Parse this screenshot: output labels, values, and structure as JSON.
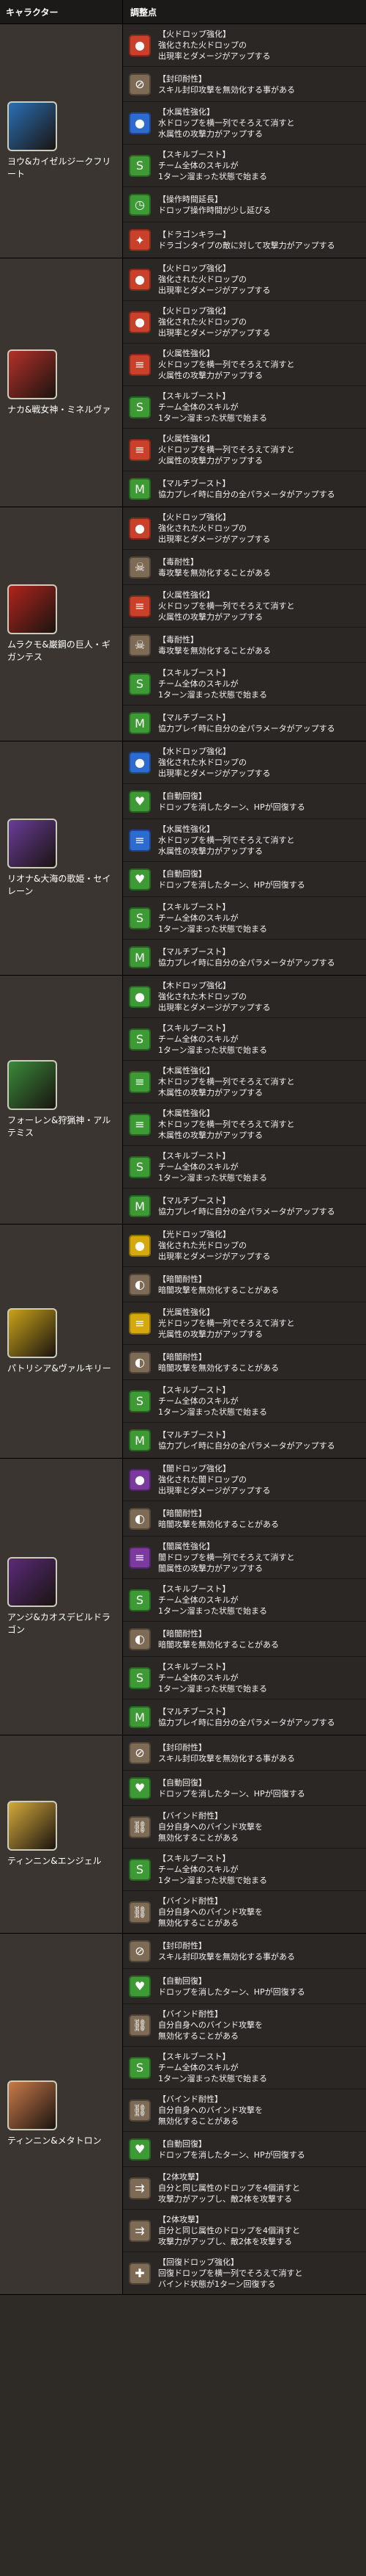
{
  "header": {
    "col1": "キャラクター",
    "col2": "調整点"
  },
  "characters": [
    {
      "name": "ヨウ&カイゼルジークフリート",
      "portrait_color": "#2a6fb5",
      "abilities": [
        {
          "icon": "fire-orb-icon",
          "color": "fire",
          "title": "【火ドロップ強化】",
          "lines": [
            "強化された火ドロップの",
            "出現率とダメージがアップする"
          ]
        },
        {
          "icon": "seal-resist-icon",
          "color": "ntrl",
          "title": "【封印耐性】",
          "lines": [
            "スキル封印攻撃を無効化する事がある"
          ]
        },
        {
          "icon": "water-orb-icon",
          "color": "water",
          "title": "【水属性強化】",
          "lines": [
            "水ドロップを横一列でそろえて消すと",
            "水属性の攻撃力がアップする"
          ]
        },
        {
          "icon": "skill-boost-icon",
          "color": "wood",
          "title": "【スキルブースト】",
          "lines": [
            "チーム全体のスキルが",
            "1ターン溜まった状態で始まる"
          ]
        },
        {
          "icon": "time-extend-icon",
          "color": "wood",
          "title": "【操作時間延長】",
          "lines": [
            "ドロップ操作時間が少し延びる"
          ]
        },
        {
          "icon": "dragon-killer-icon",
          "color": "fire",
          "title": "【ドラゴンキラー】",
          "lines": [
            "ドラゴンタイプの敵に対して攻撃力がアップする"
          ]
        }
      ]
    },
    {
      "name": "ナカ&戦女神・ミネルヴァ",
      "portrait_color": "#b5302a",
      "abilities": [
        {
          "icon": "fire-orb-icon",
          "color": "fire",
          "title": "【火ドロップ強化】",
          "lines": [
            "強化された火ドロップの",
            "出現率とダメージがアップする"
          ]
        },
        {
          "icon": "fire-orb-icon",
          "color": "fire",
          "title": "【火ドロップ強化】",
          "lines": [
            "強化された火ドロップの",
            "出現率とダメージがアップする"
          ]
        },
        {
          "icon": "fire-row-icon",
          "color": "fire",
          "title": "【火属性強化】",
          "lines": [
            "火ドロップを横一列でそろえて消すと",
            "火属性の攻撃力がアップする"
          ]
        },
        {
          "icon": "skill-boost-icon",
          "color": "wood",
          "title": "【スキルブースト】",
          "lines": [
            "チーム全体のスキルが",
            "1ターン溜まった状態で始まる"
          ]
        },
        {
          "icon": "fire-row-icon",
          "color": "fire",
          "title": "【火属性強化】",
          "lines": [
            "火ドロップを横一列でそろえて消すと",
            "火属性の攻撃力がアップする"
          ]
        },
        {
          "icon": "multi-boost-icon",
          "color": "wood",
          "title": "【マルチブースト】",
          "lines": [
            "協力プレイ時に自分の全パラメータがアップする"
          ]
        }
      ]
    },
    {
      "name": "ムラクモ&巌鋼の巨人・ギガンテス",
      "portrait_color": "#b0241c",
      "abilities": [
        {
          "icon": "fire-orb-icon",
          "color": "fire",
          "title": "【火ドロップ強化】",
          "lines": [
            "強化された火ドロップの",
            "出現率とダメージがアップする"
          ]
        },
        {
          "icon": "poison-resist-icon",
          "color": "ntrl",
          "title": "【毒耐性】",
          "lines": [
            "毒攻撃を無効化することがある"
          ]
        },
        {
          "icon": "fire-row-icon",
          "color": "fire",
          "title": "【火属性強化】",
          "lines": [
            "火ドロップを横一列でそろえて消すと",
            "火属性の攻撃力がアップする"
          ]
        },
        {
          "icon": "poison-resist-icon",
          "color": "ntrl",
          "title": "【毒耐性】",
          "lines": [
            "毒攻撃を無効化することがある"
          ]
        },
        {
          "icon": "skill-boost-icon",
          "color": "wood",
          "title": "【スキルブースト】",
          "lines": [
            "チーム全体のスキルが",
            "1ターン溜まった状態で始まる"
          ]
        },
        {
          "icon": "multi-boost-icon",
          "color": "wood",
          "title": "【マルチブースト】",
          "lines": [
            "協力プレイ時に自分の全パラメータがアップする"
          ]
        }
      ]
    },
    {
      "name": "リオナ&大海の歌姫・セイレーン",
      "portrait_color": "#6a3c9a",
      "abilities": [
        {
          "icon": "water-orb-icon",
          "color": "water",
          "title": "【水ドロップ強化】",
          "lines": [
            "強化された水ドロップの",
            "出現率とダメージがアップする"
          ]
        },
        {
          "icon": "auto-heal-icon",
          "color": "wood",
          "title": "【自動回復】",
          "lines": [
            "ドロップを消したターン、HPが回復する"
          ]
        },
        {
          "icon": "water-row-icon",
          "color": "water",
          "title": "【水属性強化】",
          "lines": [
            "水ドロップを横一列でそろえて消すと",
            "水属性の攻撃力がアップする"
          ]
        },
        {
          "icon": "auto-heal-icon",
          "color": "wood",
          "title": "【自動回復】",
          "lines": [
            "ドロップを消したターン、HPが回復する"
          ]
        },
        {
          "icon": "skill-boost-icon",
          "color": "wood",
          "title": "【スキルブースト】",
          "lines": [
            "チーム全体のスキルが",
            "1ターン溜まった状態で始まる"
          ]
        },
        {
          "icon": "multi-boost-icon",
          "color": "wood",
          "title": "【マルチブースト】",
          "lines": [
            "協力プレイ時に自分の全パラメータがアップする"
          ]
        }
      ]
    },
    {
      "name": "フォーレン&狩猟神・アルテミス",
      "portrait_color": "#3a8a3a",
      "abilities": [
        {
          "icon": "wood-orb-icon",
          "color": "wood",
          "title": "【木ドロップ強化】",
          "lines": [
            "強化された木ドロップの",
            "出現率とダメージがアップする"
          ]
        },
        {
          "icon": "skill-boost-icon",
          "color": "wood",
          "title": "【スキルブースト】",
          "lines": [
            "チーム全体のスキルが",
            "1ターン溜まった状態で始まる"
          ]
        },
        {
          "icon": "wood-row-icon",
          "color": "wood",
          "title": "【木属性強化】",
          "lines": [
            "木ドロップを横一列でそろえて消すと",
            "木属性の攻撃力がアップする"
          ]
        },
        {
          "icon": "wood-row-icon",
          "color": "wood",
          "title": "【木属性強化】",
          "lines": [
            "木ドロップを横一列でそろえて消すと",
            "木属性の攻撃力がアップする"
          ]
        },
        {
          "icon": "skill-boost-icon",
          "color": "wood",
          "title": "【スキルブースト】",
          "lines": [
            "チーム全体のスキルが",
            "1ターン溜まった状態で始まる"
          ]
        },
        {
          "icon": "multi-boost-icon",
          "color": "wood",
          "title": "【マルチブースト】",
          "lines": [
            "協力プレイ時に自分の全パラメータがアップする"
          ]
        }
      ]
    },
    {
      "name": "パトリシア&ヴァルキリー",
      "portrait_color": "#c9a21a",
      "abilities": [
        {
          "icon": "light-orb-icon",
          "color": "light",
          "title": "【光ドロップ強化】",
          "lines": [
            "強化された光ドロップの",
            "出現率とダメージがアップする"
          ]
        },
        {
          "icon": "darkness-resist-icon",
          "color": "ntrl",
          "title": "【暗闇耐性】",
          "lines": [
            "暗闇攻撃を無効化することがある"
          ]
        },
        {
          "icon": "light-row-icon",
          "color": "light",
          "title": "【光属性強化】",
          "lines": [
            "光ドロップを横一列でそろえて消すと",
            "光属性の攻撃力がアップする"
          ]
        },
        {
          "icon": "darkness-resist-icon",
          "color": "ntrl",
          "title": "【暗闇耐性】",
          "lines": [
            "暗闇攻撃を無効化することがある"
          ]
        },
        {
          "icon": "skill-boost-icon",
          "color": "wood",
          "title": "【スキルブースト】",
          "lines": [
            "チーム全体のスキルが",
            "1ターン溜まった状態で始まる"
          ]
        },
        {
          "icon": "multi-boost-icon",
          "color": "wood",
          "title": "【マルチブースト】",
          "lines": [
            "協力プレイ時に自分の全パラメータがアップする"
          ]
        }
      ]
    },
    {
      "name": "アンジ&カオスデビルドラゴン",
      "portrait_color": "#5a2a7a",
      "abilities": [
        {
          "icon": "dark-orb-icon",
          "color": "dark",
          "title": "【闇ドロップ強化】",
          "lines": [
            "強化された闇ドロップの",
            "出現率とダメージがアップする"
          ]
        },
        {
          "icon": "darkness-resist-icon",
          "color": "ntrl",
          "title": "【暗闇耐性】",
          "lines": [
            "暗闇攻撃を無効化することがある"
          ]
        },
        {
          "icon": "dark-row-icon",
          "color": "dark",
          "title": "【闇属性強化】",
          "lines": [
            "闇ドロップを横一列でそろえて消すと",
            "闇属性の攻撃力がアップする"
          ]
        },
        {
          "icon": "skill-boost-icon",
          "color": "wood",
          "title": "【スキルブースト】",
          "lines": [
            "チーム全体のスキルが",
            "1ターン溜まった状態で始まる"
          ]
        },
        {
          "icon": "darkness-resist-icon",
          "color": "ntrl",
          "title": "【暗闇耐性】",
          "lines": [
            "暗闇攻撃を無効化することがある"
          ]
        },
        {
          "icon": "skill-boost-icon",
          "color": "wood",
          "title": "【スキルブースト】",
          "lines": [
            "チーム全体のスキルが",
            "1ターン溜まった状態で始まる"
          ]
        },
        {
          "icon": "multi-boost-icon",
          "color": "wood",
          "title": "【マルチブースト】",
          "lines": [
            "協力プレイ時に自分の全パラメータがアップする"
          ]
        }
      ]
    },
    {
      "name": "ティンニン&エンジェル",
      "portrait_color": "#d4a93a",
      "abilities": [
        {
          "icon": "seal-resist-icon",
          "color": "ntrl",
          "title": "【封印耐性】",
          "lines": [
            "スキル封印攻撃を無効化する事がある"
          ]
        },
        {
          "icon": "auto-heal-icon",
          "color": "wood",
          "title": "【自動回復】",
          "lines": [
            "ドロップを消したターン、HPが回復する"
          ]
        },
        {
          "icon": "bind-resist-icon",
          "color": "ntrl",
          "title": "【バインド耐性】",
          "lines": [
            "自分自身へのバインド攻撃を",
            "無効化することがある"
          ]
        },
        {
          "icon": "skill-boost-icon",
          "color": "wood",
          "title": "【スキルブースト】",
          "lines": [
            "チーム全体のスキルが",
            "1ターン溜まった状態で始まる"
          ]
        },
        {
          "icon": "bind-resist-icon",
          "color": "ntrl",
          "title": "【バインド耐性】",
          "lines": [
            "自分自身へのバインド攻撃を",
            "無効化することがある"
          ]
        }
      ]
    },
    {
      "name": "ティンニン&メタトロン",
      "portrait_color": "#c97a4a",
      "abilities": [
        {
          "icon": "seal-resist-icon",
          "color": "ntrl",
          "title": "【封印耐性】",
          "lines": [
            "スキル封印攻撃を無効化する事がある"
          ]
        },
        {
          "icon": "auto-heal-icon",
          "color": "wood",
          "title": "【自動回復】",
          "lines": [
            "ドロップを消したターン、HPが回復する"
          ]
        },
        {
          "icon": "bind-resist-icon",
          "color": "ntrl",
          "title": "【バインド耐性】",
          "lines": [
            "自分自身へのバインド攻撃を",
            "無効化することがある"
          ]
        },
        {
          "icon": "skill-boost-icon",
          "color": "wood",
          "title": "【スキルブースト】",
          "lines": [
            "チーム全体のスキルが",
            "1ターン溜まった状態で始まる"
          ]
        },
        {
          "icon": "bind-resist-icon",
          "color": "ntrl",
          "title": "【バインド耐性】",
          "lines": [
            "自分自身へのバインド攻撃を",
            "無効化することがある"
          ]
        },
        {
          "icon": "auto-heal-icon",
          "color": "wood",
          "title": "【自動回復】",
          "lines": [
            "ドロップを消したターン、HPが回復する"
          ]
        },
        {
          "icon": "two-way-icon",
          "color": "ntrl",
          "title": "【2体攻撃】",
          "lines": [
            "自分と同じ属性のドロップを4個消すと",
            "攻撃力がアップし、敵2体を攻撃する"
          ]
        },
        {
          "icon": "two-way-icon",
          "color": "ntrl",
          "title": "【2体攻撃】",
          "lines": [
            "自分と同じ属性のドロップを4個消すと",
            "攻撃力がアップし、敵2体を攻撃する"
          ]
        },
        {
          "icon": "heal-row-icon",
          "color": "ntrl",
          "title": "【回復ドロップ強化】",
          "lines": [
            "回復ドロップを横一列でそろえて消すと",
            "バインド状態が1ターン回復する"
          ]
        }
      ]
    }
  ],
  "icon_glyphs": {
    "fire-orb-icon": "●",
    "water-orb-icon": "●",
    "wood-orb-icon": "●",
    "light-orb-icon": "●",
    "dark-orb-icon": "●",
    "fire-row-icon": "≡",
    "water-row-icon": "≡",
    "wood-row-icon": "≡",
    "light-row-icon": "≡",
    "dark-row-icon": "≡",
    "seal-resist-icon": "⊘",
    "skill-boost-icon": "S",
    "time-extend-icon": "◷",
    "dragon-killer-icon": "✦",
    "multi-boost-icon": "M",
    "poison-resist-icon": "☠",
    "auto-heal-icon": "♥",
    "darkness-resist-icon": "◐",
    "bind-resist-icon": "⛓",
    "two-way-icon": "⇉",
    "heal-row-icon": "✚"
  }
}
